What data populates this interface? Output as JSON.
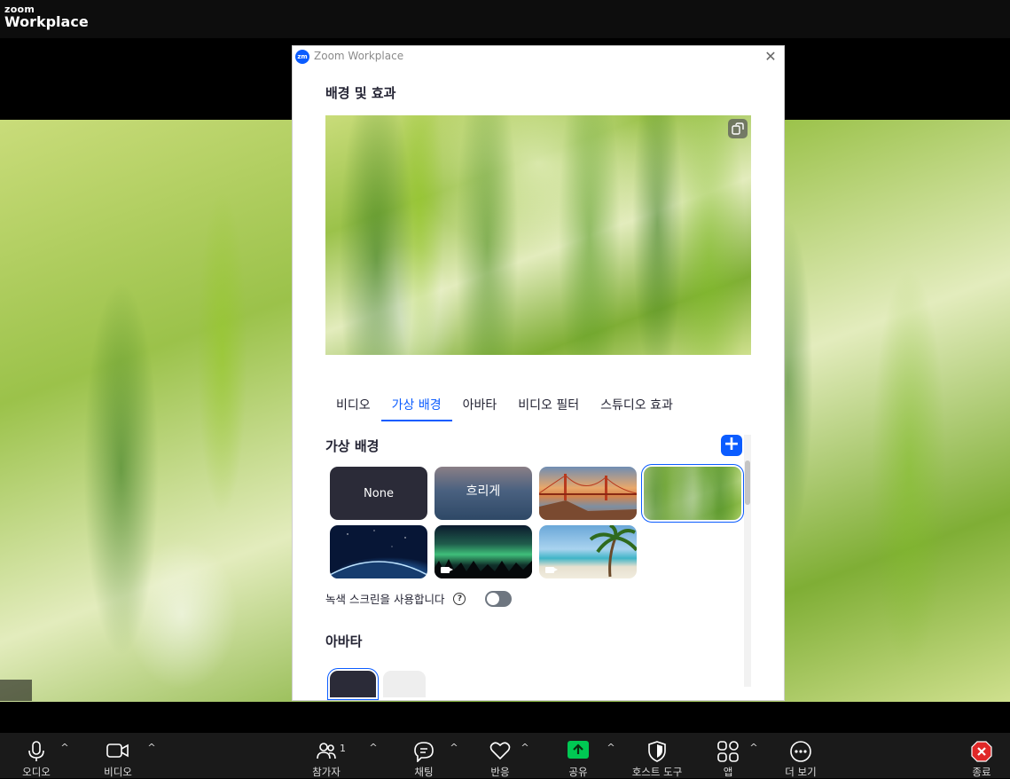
{
  "app": {
    "logo_line1": "zoom",
    "logo_line2": "Workplace"
  },
  "dialog": {
    "title": "Zoom Workplace",
    "logo_text": "zm",
    "close_glyph": "✕",
    "heading": "배경 및 효과",
    "tabs": [
      {
        "label": "비디오"
      },
      {
        "label": "가상 배경",
        "active": true
      },
      {
        "label": "아바타"
      },
      {
        "label": "비디오 필터"
      },
      {
        "label": "스튜디오 효과"
      }
    ],
    "virtual_bg": {
      "title": "가상 배경",
      "add_glyph": "+",
      "thumbs": [
        {
          "label": "None",
          "kind": "none"
        },
        {
          "label": "흐리게",
          "kind": "blur"
        },
        {
          "label": "",
          "kind": "golden-gate-bridge"
        },
        {
          "label": "",
          "kind": "grass",
          "selected": true
        },
        {
          "label": "",
          "kind": "earth-from-space"
        },
        {
          "label": "",
          "kind": "aurora",
          "video": true
        },
        {
          "label": "",
          "kind": "beach-palm",
          "video": true
        }
      ]
    },
    "green_screen": {
      "label": "녹색 스크린을 사용합니다",
      "help_glyph": "?",
      "enabled": false
    },
    "avatar_section": {
      "title": "아바타"
    }
  },
  "toolbar": {
    "audio": "오디오",
    "video": "비디오",
    "participants": "참가자",
    "participants_count": "1",
    "chat": "채팅",
    "reactions": "반응",
    "share": "공유",
    "host_tools": "호스트 도구",
    "apps": "앱",
    "more": "더 보기",
    "end": "종료"
  },
  "colors": {
    "accent": "#0b5cff",
    "share_green": "#00c853",
    "end_red": "#e02828"
  }
}
